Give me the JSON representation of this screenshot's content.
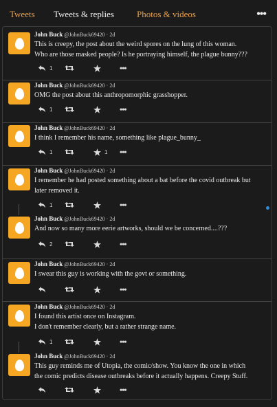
{
  "tabs": {
    "tweets": "Tweets",
    "replies": "Tweets & replies",
    "photos": "Photos & videos",
    "more": "•••"
  },
  "colors": {
    "accent": "#e8a04a",
    "avatar": "#f5a623",
    "background": "#1b1b1b",
    "scroll_indicator": "#2d8ee0"
  },
  "tweets": [
    {
      "name": "John Buck",
      "handle": "@JohnBuck69420",
      "time": "· 2d",
      "text": [
        "This is creepy, the post about the weird spores on the lung of this woman.",
        "Who are those masked people? Is he portraying himself, the plague bunny???"
      ],
      "replies": "1",
      "retweets": "",
      "likes": ""
    },
    {
      "name": "John Buck",
      "handle": "@JohnBuck69420",
      "time": "· 2d",
      "text": [
        "OMG the post about this anthropomorphic grasshopper."
      ],
      "replies": "1",
      "retweets": "",
      "likes": ""
    },
    {
      "name": "John Buck",
      "handle": "@JohnBuck69420",
      "time": "· 2d",
      "text": [
        "I think I remember his name, something like plague_bunny_"
      ],
      "replies": "1",
      "retweets": "",
      "likes": "1"
    },
    {
      "name": "John Buck",
      "handle": "@JohnBuck69420",
      "time": "· 2d",
      "text": [
        "I remember he had posted something about a bat before the covid outbreak but",
        "later removed it."
      ],
      "replies": "1",
      "retweets": "",
      "likes": ""
    },
    {
      "name": "John Buck",
      "handle": "@JohnBuck69420",
      "time": "· 2d",
      "text": [
        "And now so many more eerie artworks, should we be concerned....???"
      ],
      "replies": "2",
      "retweets": "",
      "likes": ""
    },
    {
      "name": "John Buck",
      "handle": "@JohnBuck69420",
      "time": "· 2d",
      "text": [
        "I swear this guy is working with the govt or something."
      ],
      "replies": "",
      "retweets": "",
      "likes": ""
    },
    {
      "name": "John Buck",
      "handle": "@JohnBuck69420",
      "time": "· 2d",
      "text": [
        "I found this artist once on Instagram.",
        "I don't remember clearly, but a rather strange name."
      ],
      "replies": "1",
      "retweets": "",
      "likes": ""
    },
    {
      "name": "John Buck",
      "handle": "@JohnBuck69420",
      "time": "· 2d",
      "text": [
        "This guy reminds me of Utopia, the comic/show. You know the one in which",
        "the comic predicts disease outbreaks before it actually happens. Creepy Stuff."
      ],
      "replies": "",
      "retweets": "",
      "likes": ""
    }
  ]
}
